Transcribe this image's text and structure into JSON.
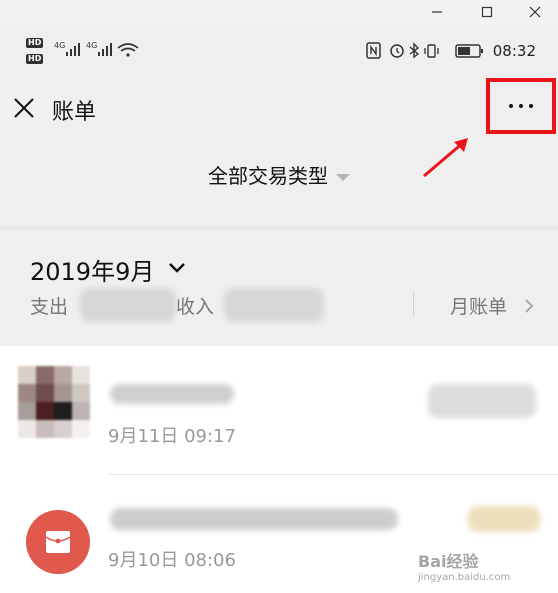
{
  "window": {
    "controls": [
      "minimize-icon",
      "maximize-icon",
      "close-icon"
    ]
  },
  "status_bar": {
    "left_labels": [
      "HD",
      "4G",
      "4G"
    ],
    "time": "08:32",
    "icons": [
      "nfc-icon",
      "alarm-icon",
      "bluetooth-icon",
      "vibrate-icon",
      "battery-icon"
    ]
  },
  "header": {
    "title": "账单",
    "close_icon": "close-icon",
    "more_icon": "more-dots-icon",
    "highlight_color": "#e8141a"
  },
  "filter": {
    "label": "全部交易类型"
  },
  "summary": {
    "month": "2019年9月",
    "expense_label": "支出",
    "income_label": "收入",
    "monthly_bill_label": "月账单"
  },
  "transactions": [
    {
      "date": "9月11日 09:17",
      "icon": "contact-avatar"
    },
    {
      "date": "9月10日 08:06",
      "icon": "red-packet-icon"
    }
  ],
  "watermark": {
    "text": "Bai经验",
    "sub": "jingyan.baidu.com"
  }
}
